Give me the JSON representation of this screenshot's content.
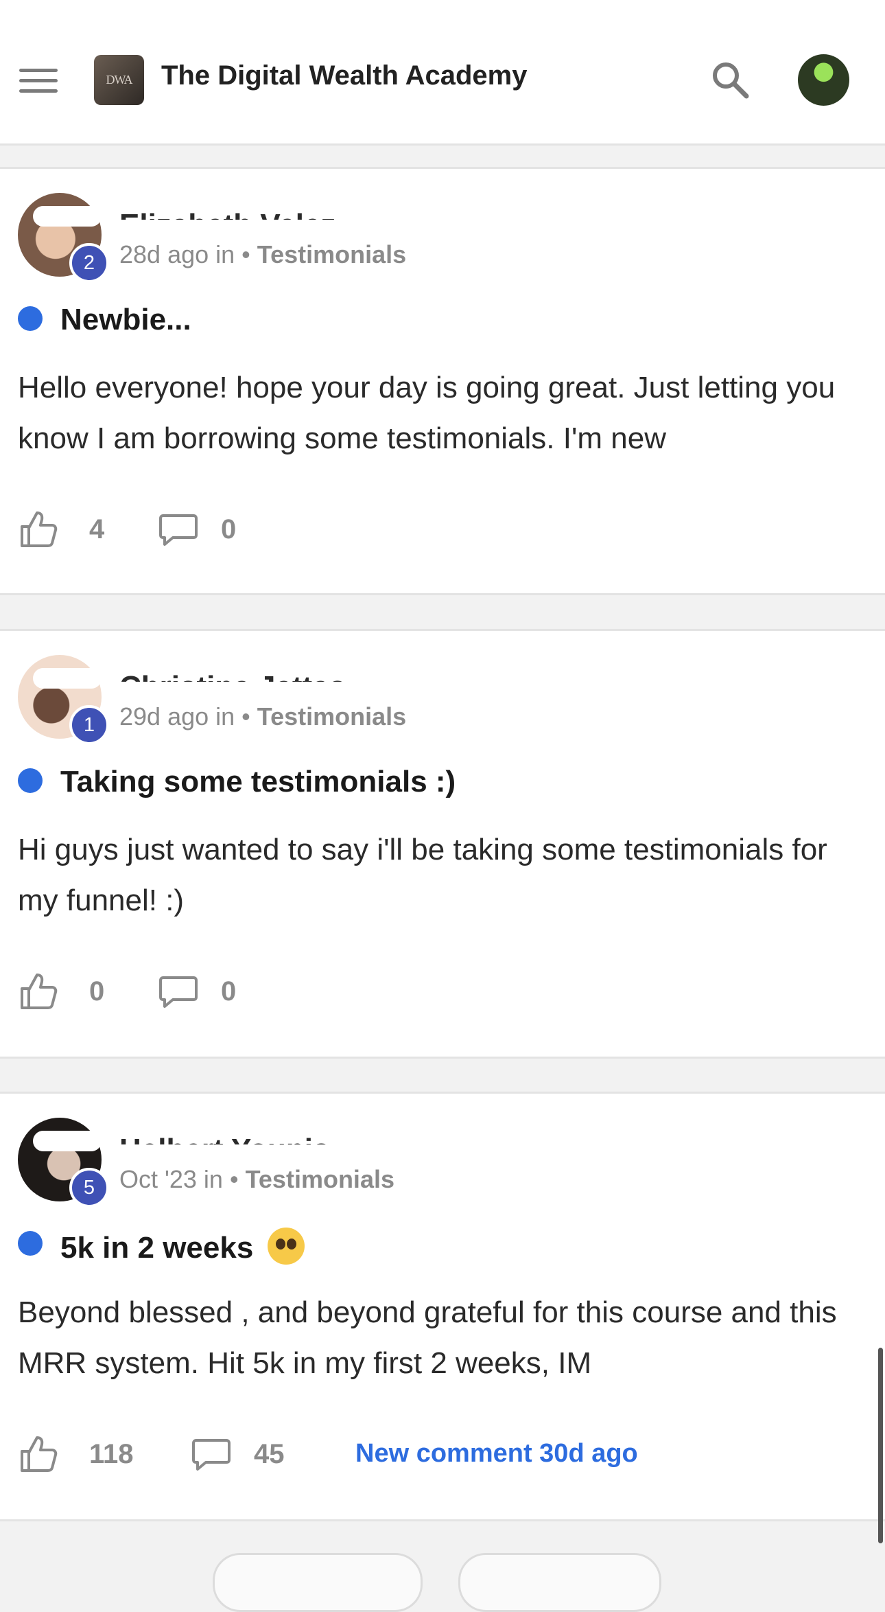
{
  "app": {
    "title": "The Digital Wealth Academy",
    "logo_text": "DWA"
  },
  "posts": [
    {
      "author": "Elizabeth Velez",
      "level": "2",
      "time": "28d ago in",
      "separator": "•",
      "category": "Testimonials",
      "title": "Newbie...",
      "body": "Hello everyone! hope your day is going great. Just letting you know I am borrowing some testimonials. I'm new",
      "likes": "4",
      "comments": "0"
    },
    {
      "author": "Christina Jattas",
      "level": "1",
      "time": "29d ago in",
      "separator": "•",
      "category": "Testimonials",
      "title": "Taking some testimonials :)",
      "body": "Hi guys just wanted to say i'll be taking some testimonials for my funnel! :)",
      "likes": "0",
      "comments": "0"
    },
    {
      "author": "Helbert Younis",
      "level": "5",
      "time": "Oct '23 in",
      "separator": "•",
      "category": "Testimonials",
      "title": "5k in 2 weeks",
      "body": "Beyond blessed , and beyond grateful for this course and this MRR system. Hit 5k in my first 2 weeks, IM",
      "likes": "118",
      "comments": "45",
      "new_comment": "New comment 30d ago"
    }
  ],
  "icons": {
    "menu": "menu-icon",
    "search": "search-icon",
    "like": "thumbs-up-icon",
    "comment": "comment-icon",
    "emoji": "pleading-face-emoji"
  },
  "colors": {
    "accent": "#2d6cdf",
    "badge": "#3f51b5",
    "muted": "#8a8a8a",
    "background": "#f2f2f2"
  }
}
